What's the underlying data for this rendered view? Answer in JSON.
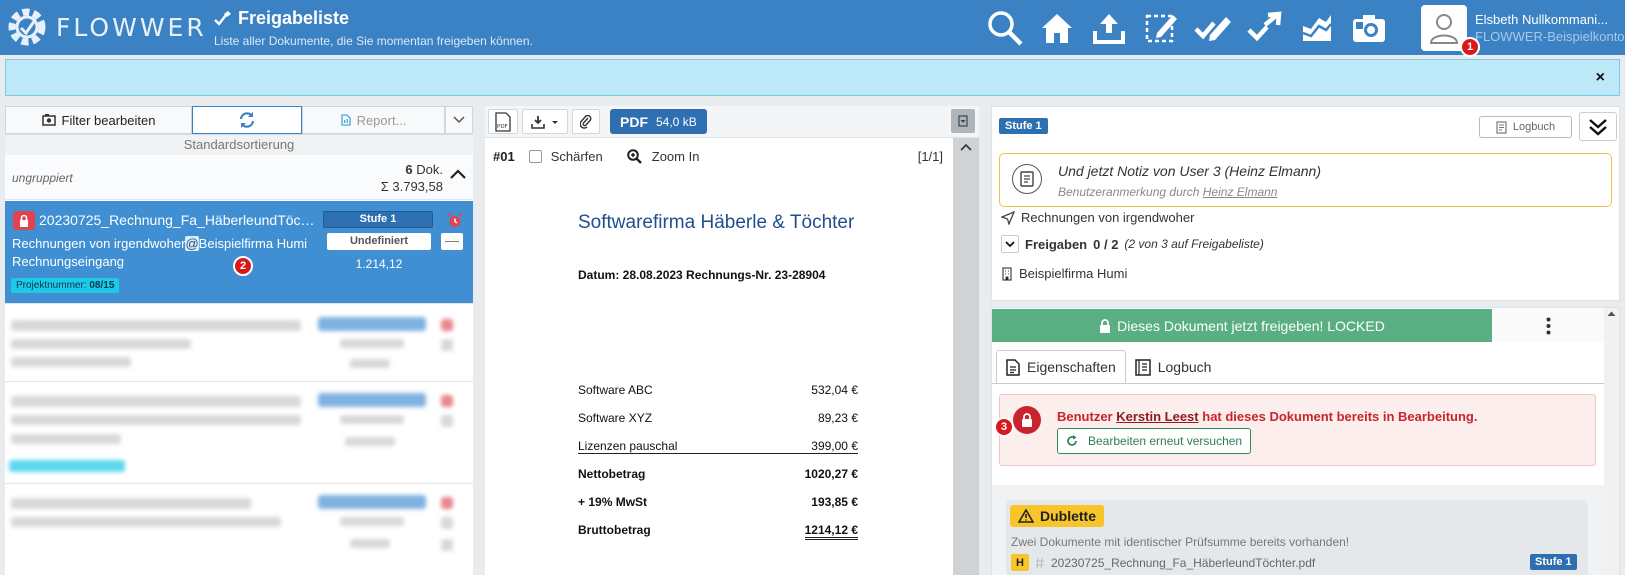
{
  "header": {
    "logo_text": "FLOWWER",
    "title": "Freigabeliste",
    "subtitle": "Liste aller Dokumente, die Sie momentan freigeben können.",
    "toolbar_icons": [
      "search-icon",
      "home-icon",
      "upload-icon",
      "edit-frame-icon",
      "pen-icon",
      "arrow-forward-icon",
      "chart-icon",
      "camera-icon"
    ],
    "user": {
      "name": "Elsbeth Nullkommani...",
      "account": "FLOWWER-Beispielkonto"
    },
    "brand_color": "#3b82c4"
  },
  "callouts": [
    "1",
    "2",
    "3"
  ],
  "infobar": {
    "close_label": "×"
  },
  "list": {
    "filter_label": "Filter bearbeiten",
    "report_label": "Report...",
    "sort_label": "Standardsortierung",
    "group": {
      "name": "ungruppiert",
      "count": "6",
      "count_unit": "Dok.",
      "sum": "Σ 3.793,58"
    },
    "selected_doc": {
      "title": "20230725_Rechnung_Fa_HäberleundTöchter.pdf",
      "line2_a": "Rechnungen von irgendwoher",
      "line2_at": "@",
      "line2_b": "Beispielfirma Humi",
      "line3": "Rechnungseingang",
      "tag_label": "Projektnummer:",
      "tag_value": "08/15",
      "stage": "Stufe 1",
      "status": "Undefiniert",
      "amount": "1.214,12"
    }
  },
  "viewer": {
    "pdf_label": "PDF",
    "pdf_size": "54,0 kB",
    "page_num": "#01",
    "sharpen_label": "Schärfen",
    "zoom_label": "Zoom In",
    "page_count": "[1/1]",
    "invoice": {
      "company": "Softwarefirma Häberle & Töchter",
      "meta": "Datum: 28.08.2023 Rechnungs-Nr. 23-28904",
      "rows": [
        {
          "label": "Software ABC",
          "value": "532,04 €"
        },
        {
          "label": "Software XYZ",
          "value": "89,23 €"
        },
        {
          "label": "Lizenzen pauschal",
          "value": "399,00 €"
        },
        {
          "label": "Nettobetrag",
          "value": "1020,27 €"
        },
        {
          "label": "+ 19% MwSt",
          "value": "193,85 €"
        },
        {
          "label": "Bruttobetrag",
          "value": "1214,12 €"
        }
      ]
    }
  },
  "detail": {
    "stage": "Stufe 1",
    "logbuch_label": "Logbuch",
    "note_title": "Und jetzt Notiz von User 3 (Heinz Elmann)",
    "note_sub_prefix": "Benutzeranmerkung durch",
    "note_sub_user": "Heinz Elmann",
    "workflow": "Rechnungen von irgendwoher",
    "approvals_label": "Freigaben",
    "approvals_value": "0 / 2",
    "approvals_note": "(2 von 3 auf Freigabeliste)",
    "company": "Beispielfirma Humi",
    "release_label": "Dieses Dokument jetzt freigeben! LOCKED",
    "tab_properties": "Eigenschaften",
    "tab_log": "Logbuch",
    "alert_prefix": "Benutzer",
    "alert_user": "Kerstin Leest",
    "alert_suffix": "hat dieses Dokument bereits in Bearbeitung.",
    "retry_label": "Bearbeiten erneut versuchen",
    "duplicate_label": "Dublette",
    "duplicate_text": "Zwei Dokumente mit identischer Prüfsumme bereits vorhanden!",
    "duplicate_marker": "H",
    "duplicate_file": "20230725_Rechnung_Fa_HäberleundTöchter.pdf",
    "duplicate_stage": "Stufe 1"
  }
}
